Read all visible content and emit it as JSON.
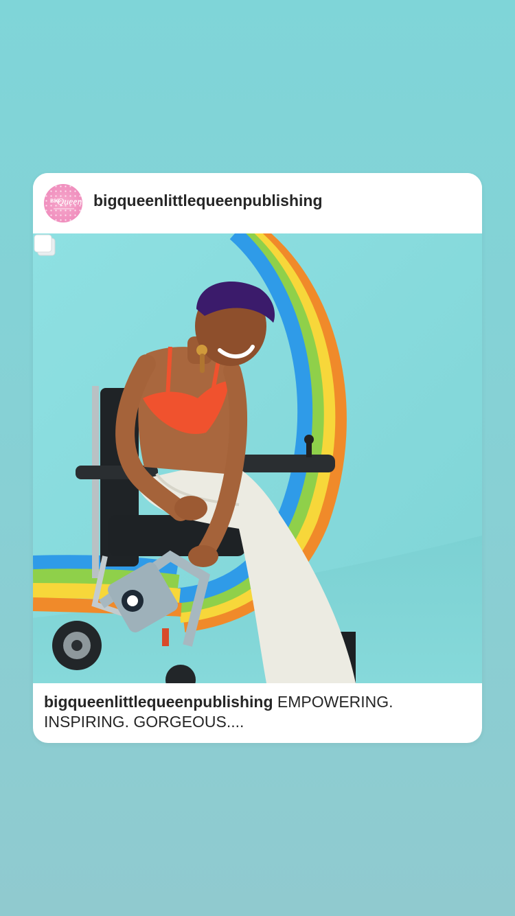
{
  "post": {
    "username": "bigqueenlittlequeenpublishing",
    "avatar_icon": "bigqueen-logo-avatar",
    "caption_username": "bigqueenlittlequeenpublishing",
    "caption_text": "EMPOWERING. INSPIRING. GORGEOUS....",
    "multi_image_indicator_icon": "carousel-multiple-icon",
    "photo": "woman-in-wheelchair-rainbow-photo"
  },
  "colors": {
    "story_background": "#82d2d6",
    "card_background": "#ffffff",
    "text_primary": "#262626",
    "avatar_pink": "#f08fbe"
  }
}
